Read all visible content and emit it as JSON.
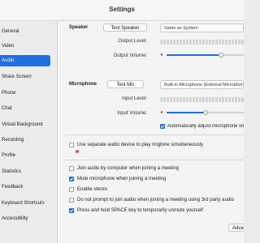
{
  "window": {
    "title": "Settings"
  },
  "sidebar": {
    "items": [
      {
        "label": "General",
        "active": false
      },
      {
        "label": "Video",
        "active": false
      },
      {
        "label": "Audio",
        "active": true
      },
      {
        "label": "Share Screen",
        "active": false
      },
      {
        "label": "Phone",
        "active": false
      },
      {
        "label": "Chat",
        "active": false
      },
      {
        "label": "Virtual Background",
        "active": false
      },
      {
        "label": "Recording",
        "active": false
      },
      {
        "label": "Profile",
        "active": false
      },
      {
        "label": "Statistics",
        "active": false
      },
      {
        "label": "Feedback",
        "active": false
      },
      {
        "label": "Keyboard Shortcuts",
        "active": false
      },
      {
        "label": "Accessibility",
        "active": false
      }
    ]
  },
  "speaker": {
    "section_label": "Speaker",
    "test_button": "Test Speaker",
    "device_select": "Same as System",
    "output_level_label": "Output Level:",
    "output_volume_label": "Output Volume:",
    "volume": 0.7
  },
  "microphone": {
    "section_label": "Microphone",
    "test_button": "Test Mic",
    "device_select": "Built-in Microphone (External Microphone)",
    "input_level_label": "Input Level:",
    "input_volume_label": "Input Volume:",
    "volume": 0.5,
    "auto_adjust_label": "Automatically adjust microphone volume",
    "auto_adjust_checked": true
  },
  "ringtone": {
    "label": "Use separate audio device to play ringtone simultaneously",
    "checked": false
  },
  "options": [
    {
      "label": "Join audio by computer when joining a meeting",
      "checked": false
    },
    {
      "label": "Mute microphone when joining a meeting",
      "checked": true
    },
    {
      "label": "Enable stereo",
      "checked": false
    },
    {
      "label": "Do not prompt to join audio when joining a meeting using 3rd party audio",
      "checked": false
    },
    {
      "label": "Press and hold SPACE key to temporarily unmute yourself",
      "checked": true
    }
  ],
  "advanced_button": "Advanced",
  "icons": {
    "volume_low": "speaker-low-icon",
    "volume_high": "speaker-high-icon"
  },
  "colors": {
    "accent": "#1f6fe5",
    "alert": "#e8484f"
  }
}
